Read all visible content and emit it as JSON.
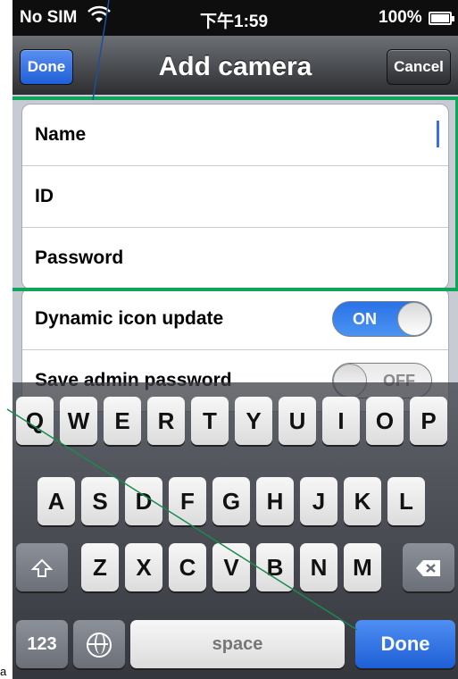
{
  "status_bar": {
    "carrier": "No SIM",
    "wifi_icon": "wifi-icon",
    "time": "下午1:59",
    "battery_text": "100%",
    "battery_icon": "battery-icon"
  },
  "nav": {
    "done_label": "Done",
    "title": "Add camera",
    "cancel_label": "Cancel"
  },
  "form": {
    "fields": [
      {
        "label": "Name"
      },
      {
        "label": "ID"
      },
      {
        "label": "Password"
      }
    ],
    "settings": [
      {
        "label": "Dynamic icon update",
        "toggle": "ON"
      },
      {
        "label": "Save admin password",
        "toggle": "OFF"
      }
    ]
  },
  "keyboard": {
    "row1": [
      "Q",
      "W",
      "E",
      "R",
      "T",
      "Y",
      "U",
      "I",
      "O",
      "P"
    ],
    "row2": [
      "A",
      "S",
      "D",
      "F",
      "G",
      "H",
      "J",
      "K",
      "L"
    ],
    "row3": [
      "Z",
      "X",
      "C",
      "V",
      "B",
      "N",
      "M"
    ],
    "numbers_label": "123",
    "space_label": "space",
    "done_label": "Done",
    "shift_icon": "shift-icon",
    "delete_icon": "backspace-icon",
    "globe_icon": "globe-icon"
  },
  "colors": {
    "highlight": "#10a55a",
    "accent_blue": "#1f5fd8"
  },
  "annotation_label": "a"
}
